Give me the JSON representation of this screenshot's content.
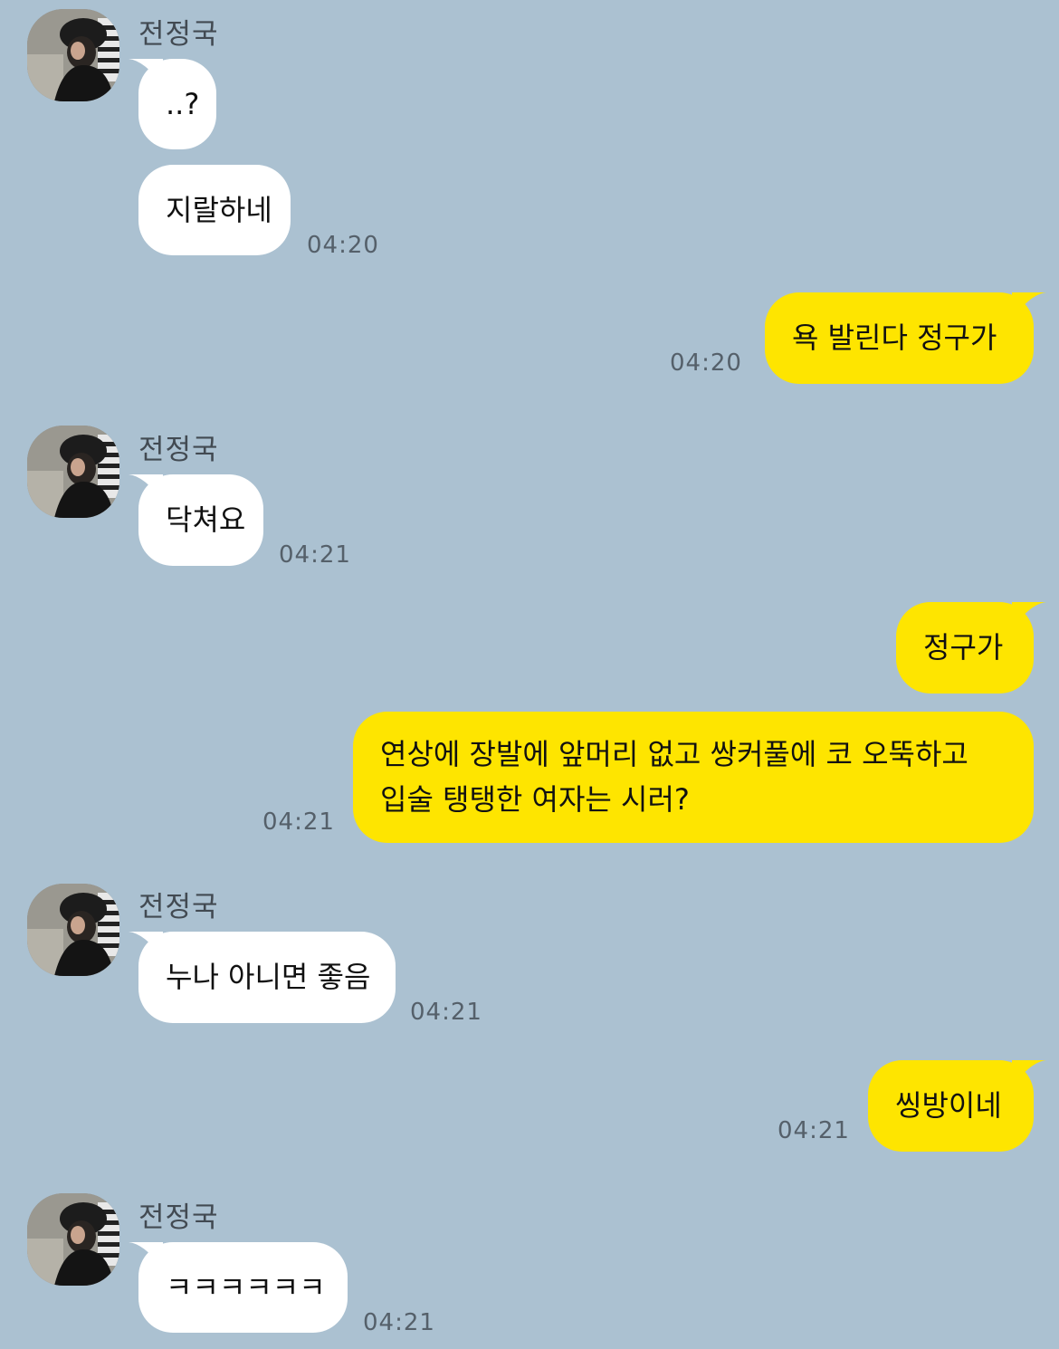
{
  "chat": {
    "sender": "전정국",
    "messages": [
      {
        "from": "them",
        "text": "..?"
      },
      {
        "from": "them",
        "text": "지랄하네",
        "time": "04:20"
      },
      {
        "from": "me",
        "text": "욕 발린다 정구가",
        "time": "04:20"
      },
      {
        "from": "them",
        "text": "닥쳐요",
        "time": "04:21"
      },
      {
        "from": "me",
        "text": "정구가"
      },
      {
        "from": "me",
        "text_line1": "연상에 장발에 앞머리 없고 쌍커풀에 코 오뚝하고",
        "text_line2": "입술 탱탱한 여자는 시러?",
        "time": "04:21"
      },
      {
        "from": "them",
        "text": "누나 아니면 좋음",
        "time": "04:21"
      },
      {
        "from": "me",
        "text": "씽방이네",
        "time": "04:21"
      },
      {
        "from": "them",
        "text": "ㅋㅋㅋㅋㅋㅋ",
        "time": "04:21"
      }
    ]
  },
  "colors": {
    "background": "#abc1d1",
    "incoming_bubble": "#ffffff",
    "outgoing_bubble": "#fee500"
  },
  "icons": {
    "avatar": "profile-photo"
  }
}
